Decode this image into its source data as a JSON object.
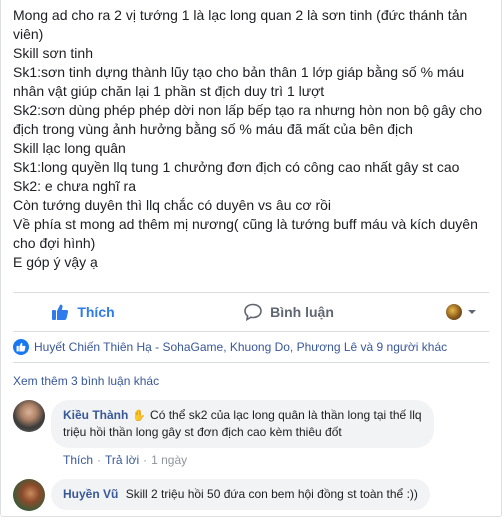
{
  "post": {
    "lines": [
      "Mong ad cho ra 2 vị tướng 1 là lạc long quan 2 là sơn tinh (đức thánh tản",
      "viên)",
      "Skill sơn tinh",
      "Sk1:sơn tinh dựng thành lũy tạo cho bản thân 1 lớp giáp bằng số % máu",
      "nhân vật giúp chăn lại 1 phần st địch duy trì 1 lượt",
      "Sk2:sơn dùng phép phép dời non lấp bếp tạo ra nhưng hòn non bộ gây cho",
      "địch trong vùng ảnh hưởng bằng số % máu đã mất của bên địch",
      "Skill lạc long quân",
      "Sk1:long quyền llq tung 1 chưởng đơn địch có công cao nhất gây st cao",
      "Sk2: e chưa nghĩ ra",
      "Còn tướng duyên thì llq chắc có duyên vs âu cơ rồi",
      "Về phía st mong ad thêm mị nương( cũng là tướng buff máu và kích duyên",
      "cho đợi hình)",
      "E góp ý vậy ạ"
    ]
  },
  "actions": {
    "like_label": "Thích",
    "comment_label": "Bình luận"
  },
  "reactions": {
    "text": "Huyết Chiến Thiên Hạ - SohaGame, Khuong Do, Phương Lê và 9 người khác"
  },
  "comments": {
    "more_label": "Xem thêm 3 bình luận khác",
    "items": [
      {
        "author": "Kiều Thành",
        "text_line1": "Có thể sk2 của lạc long quân là thần long tại thế llq",
        "text_line2": "triệu hồi thần long gây st đơn địch cao kèm thiêu đốt",
        "like_label": "Thích",
        "reply_label": "Trả lời",
        "time": "1 ngày"
      },
      {
        "author": "Huyền Vũ",
        "text_line1": "Skill 2 triệu hồi 50 đứa con bem hội đồng st toàn thể :))"
      }
    ]
  },
  "colors": {
    "accent": "#2d7bec",
    "link": "#385898",
    "muted": "#606770",
    "bubble": "#f2f3f5"
  }
}
